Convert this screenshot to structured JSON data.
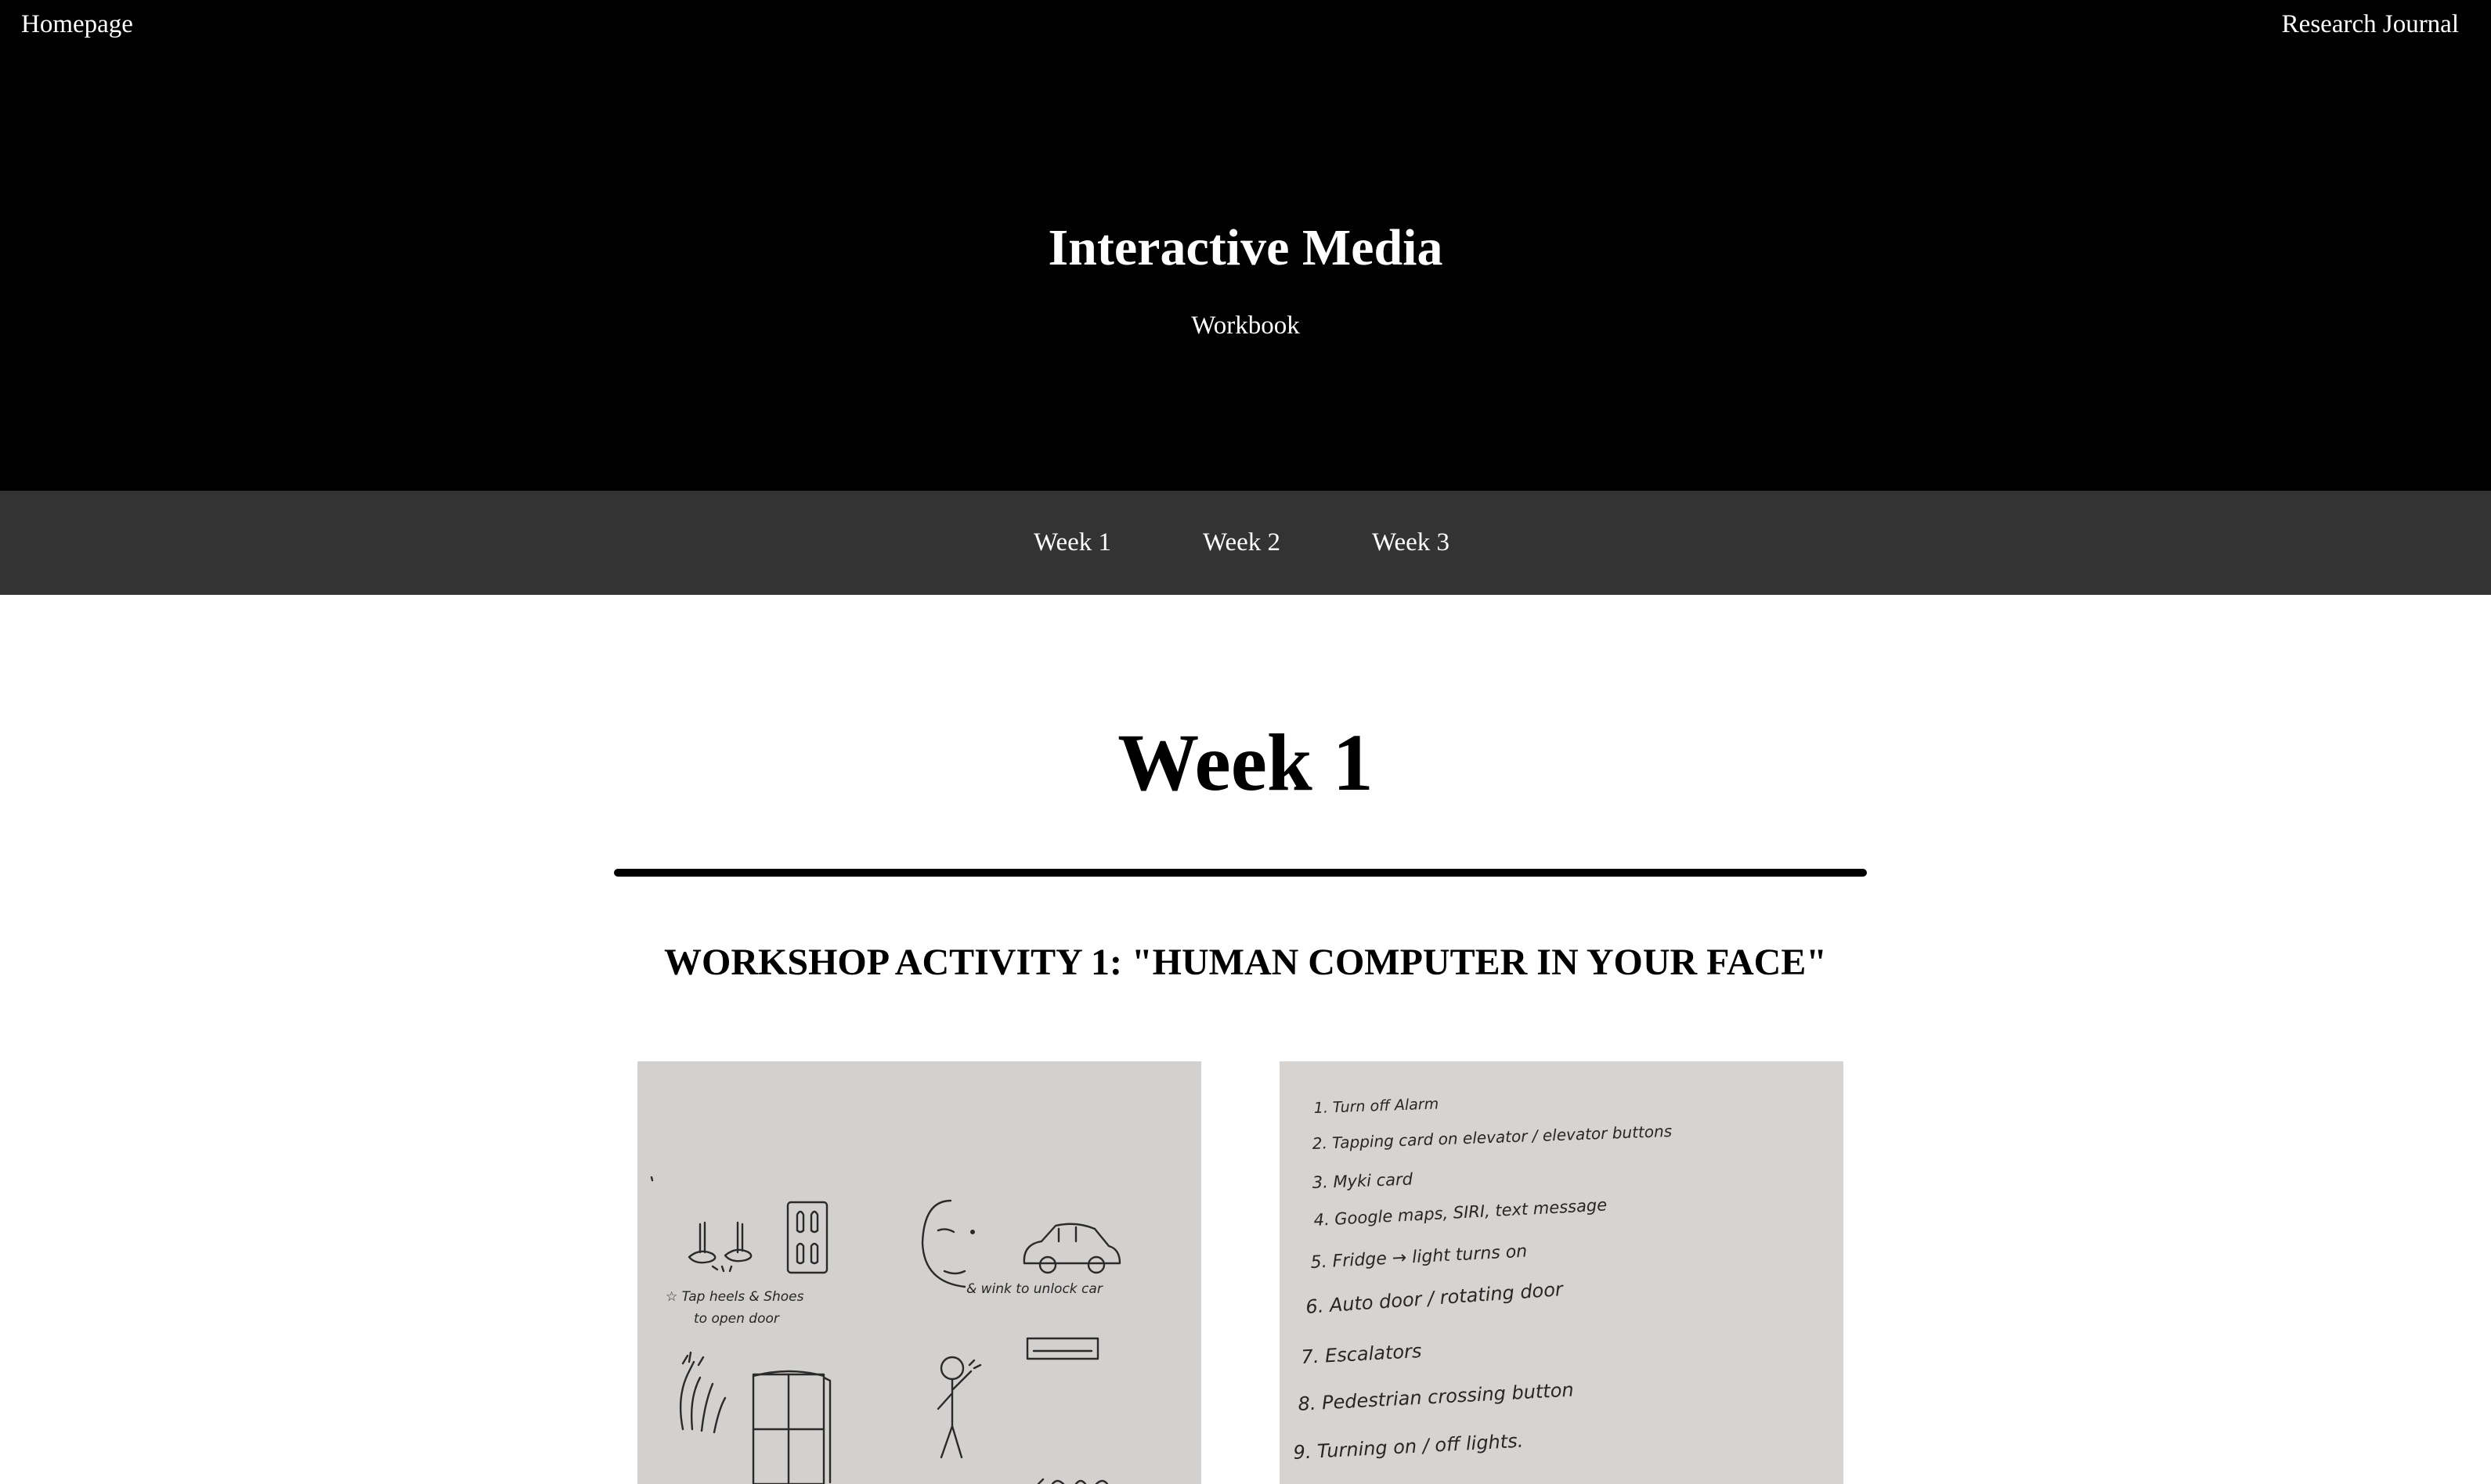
{
  "header": {
    "home_link": "Homepage",
    "journal_link": "Research Journal",
    "title": "Interactive Media",
    "subtitle": "Workbook",
    "background_color": "#000000"
  },
  "nav": {
    "background_color": "#333333",
    "items": [
      {
        "label": "Week 1"
      },
      {
        "label": "Week 2"
      },
      {
        "label": "Week 3"
      }
    ]
  },
  "main": {
    "week_title": "Week 1",
    "activity_heading": "WORKSHOP ACTIVITY 1: \"HUMAN COMPUTER IN YOUR FACE\""
  },
  "photos": {
    "left": {
      "captions": [
        "☆ Tap heels & Shoes",
        "to open door",
        "& wink to unlock car"
      ]
    },
    "right": {
      "list": [
        "1. Turn off Alarm",
        "2. Tapping card on elevator / elevator buttons",
        "3. Myki card",
        "4. Google maps, SIRI, text message",
        "5. Fridge → light turns on",
        "6. Auto door / rotating door",
        "7. Escalators",
        "8. Pedestrian crossing button",
        "9. Turning on / off lights."
      ]
    }
  }
}
